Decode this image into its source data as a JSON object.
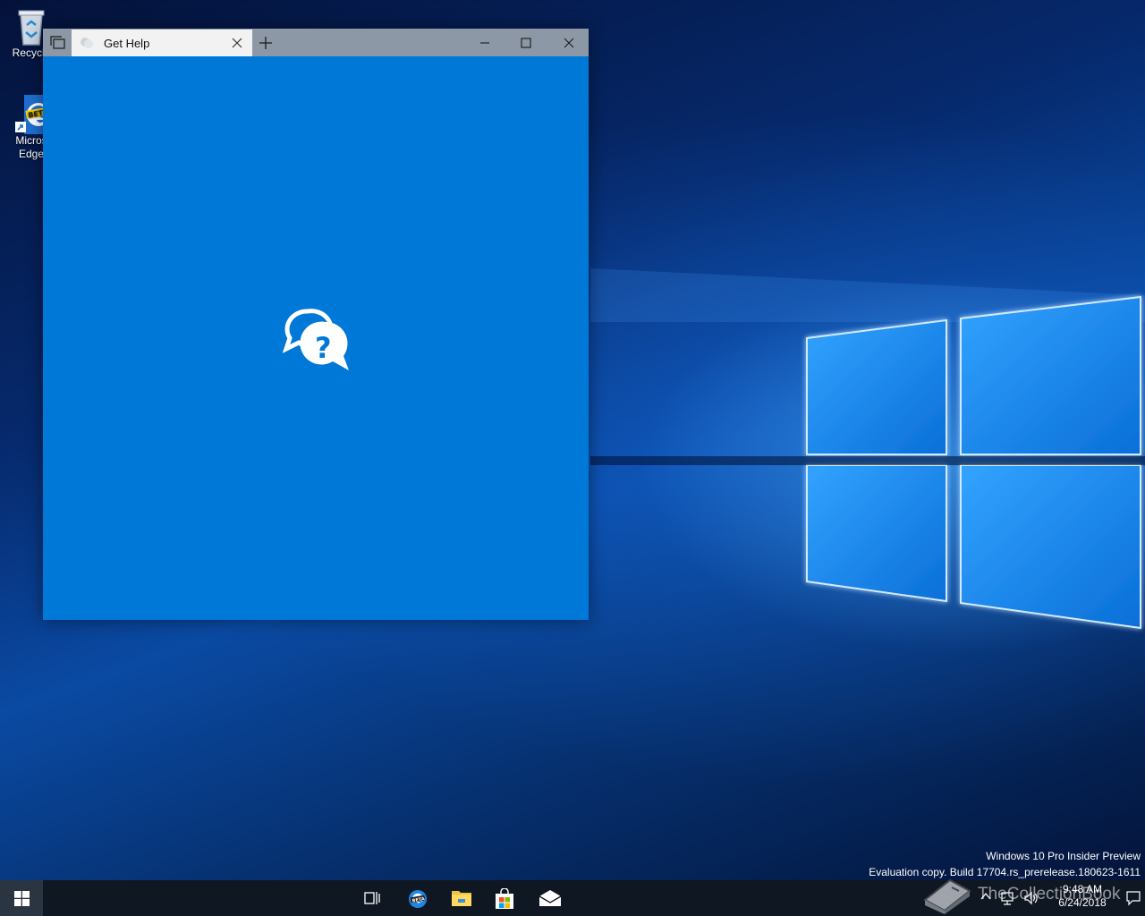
{
  "desktop": {
    "icons": [
      {
        "label": "Recycle",
        "icon": "recycle-bin-icon"
      },
      {
        "label": "Micros",
        "label2": "Edge",
        "icon": "edge-beta-icon"
      }
    ]
  },
  "window": {
    "tab_title": "Get Help",
    "tab_icon": "chat-bubbles-icon",
    "splash_icon": "chat-help-icon",
    "background_color": "#0078d7"
  },
  "watermark": {
    "line1": "Windows 10 Pro Insider Preview",
    "line2": "Evaluation copy. Build 17704.rs_prerelease.180623-1611"
  },
  "taskbar": {
    "pinned": [
      "task-view-icon",
      "edge-beta-icon",
      "file-explorer-icon",
      "store-icon",
      "mail-icon"
    ],
    "clock_time": "9:48 AM",
    "clock_date": "6/24/2018"
  },
  "overlay": {
    "text": "TheCollectionBook"
  }
}
